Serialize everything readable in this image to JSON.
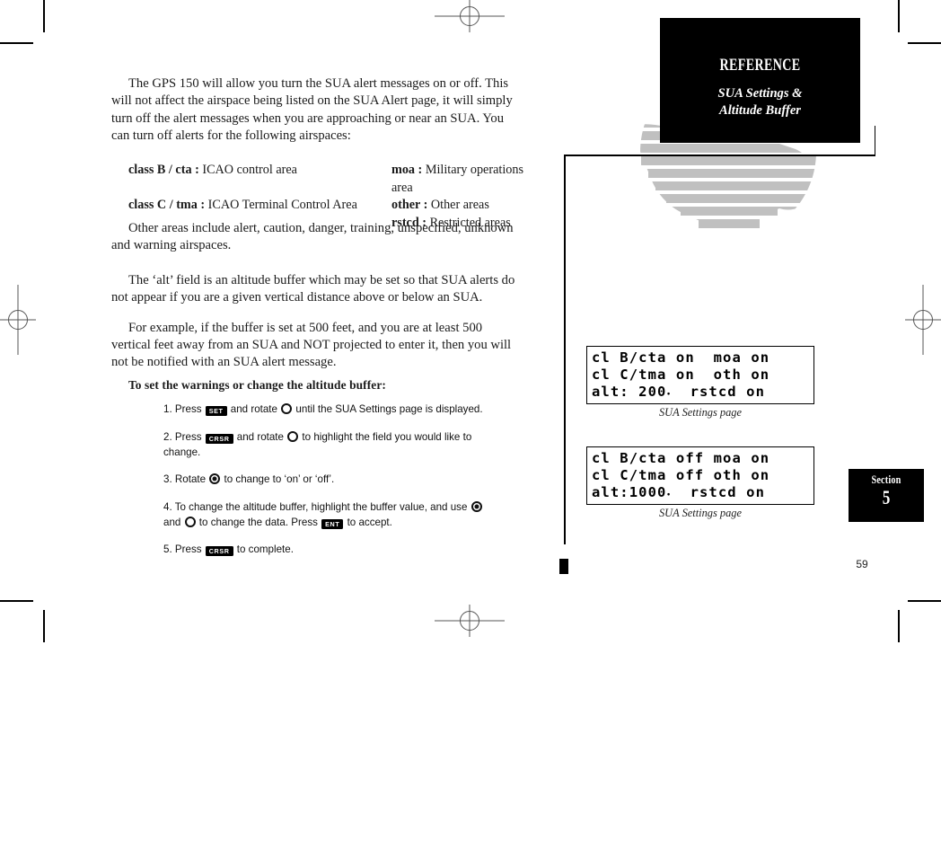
{
  "header": {
    "section_label": "REFERENCE",
    "topic_line1": "SUA Settings &",
    "topic_line2": "Altitude Buffer"
  },
  "body": {
    "para1": "The GPS 150 will allow you turn the SUA alert messages on or off. This will not affect the airspace being listed on the SUA Alert page, it will simply turn off the alert messages when you are approaching or near an SUA. You can turn off alerts for the following airspaces:",
    "para2": "Other areas include alert, caution, danger, training, unspecified, unknown and warning airspaces.",
    "para3": "The ‘alt’ field is an altitude buffer which may be set so that SUA alerts do not appear if you are a given vertical distance above or below an SUA.",
    "para4": "For example, if the buffer is set at 500 feet, and you are at least 500 vertical feet away from an SUA and NOT projected to enter it, then you will not be notified with an SUA alert message."
  },
  "airspace_definitions": {
    "rows": [
      {
        "left_term": "class B / cta :",
        "left_desc": "ICAO control area",
        "right_term": "moa :",
        "right_desc": "Military operations area"
      },
      {
        "left_term": "class C / tma :",
        "left_desc": "ICAO Terminal Control Area",
        "right_term": "other :",
        "right_desc": "Other areas"
      },
      {
        "left_term": "",
        "left_desc": "",
        "right_term": "rstcd :",
        "right_desc": "Restricted areas"
      }
    ]
  },
  "procedure": {
    "heading": "To set the warnings or change the altitude buffer:",
    "steps": [
      {
        "number": "1.",
        "parts": [
          {
            "kind": "text",
            "value": "Press "
          },
          {
            "kind": "keycap",
            "value": "SET"
          },
          {
            "kind": "text",
            "value": " and rotate "
          },
          {
            "kind": "knob",
            "value": "outer-knob"
          },
          {
            "kind": "text",
            "value": " until the SUA Settings page is displayed."
          }
        ]
      },
      {
        "number": "2.",
        "parts": [
          {
            "kind": "text",
            "value": "Press "
          },
          {
            "kind": "keycap",
            "value": "CRSR"
          },
          {
            "kind": "text",
            "value": " and rotate "
          },
          {
            "kind": "knob",
            "value": "outer-knob"
          },
          {
            "kind": "text",
            "value": " to highlight the field you would like to change."
          }
        ]
      },
      {
        "number": "3.",
        "parts": [
          {
            "kind": "text",
            "value": "Rotate "
          },
          {
            "kind": "knob-filled",
            "value": "inner-knob"
          },
          {
            "kind": "text",
            "value": " to change to ‘on’ or ‘off’."
          }
        ]
      },
      {
        "number": "4.",
        "parts": [
          {
            "kind": "text",
            "value": "To change the altitude buffer, highlight the buffer value, and use "
          },
          {
            "kind": "knob-filled",
            "value": "inner-knob"
          },
          {
            "kind": "text",
            "value": " and "
          },
          {
            "kind": "knob",
            "value": "outer-knob"
          },
          {
            "kind": "text",
            "value": " to change the data. Press "
          },
          {
            "kind": "keycap",
            "value": "ENT"
          },
          {
            "kind": "text",
            "value": " to accept."
          }
        ]
      },
      {
        "number": "5.",
        "parts": [
          {
            "kind": "text",
            "value": "Press "
          },
          {
            "kind": "keycap",
            "value": "CRSR"
          },
          {
            "kind": "text",
            "value": " to complete."
          }
        ]
      }
    ]
  },
  "figures": [
    {
      "id": "sua-settings-on",
      "lines": [
        "cl B/cta on  moa on",
        "cl C/tma on  oth on",
        "alt: 200⸳  rstcd on"
      ],
      "caption": "SUA Settings page"
    },
    {
      "id": "sua-settings-off",
      "lines": [
        "cl B/cta off moa on",
        "cl C/tma off oth on",
        "alt:1000⸳  rstcd on"
      ],
      "caption": "SUA Settings page"
    }
  ],
  "section_badge": {
    "label": "Section",
    "number": "5"
  },
  "footer": {
    "page_number": "59"
  },
  "colors": {
    "ink": "#000000",
    "paper": "#ffffff",
    "watermark": "#c0c0c0",
    "reg_mark": "#555555"
  }
}
